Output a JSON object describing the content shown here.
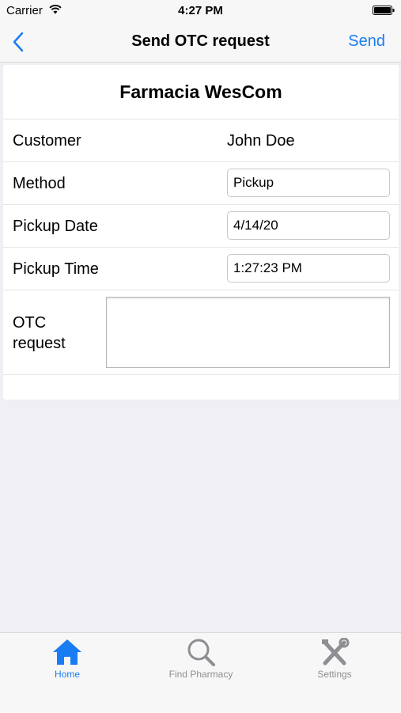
{
  "status_bar": {
    "carrier": "Carrier",
    "time": "4:27 PM"
  },
  "nav": {
    "title": "Send OTC request",
    "send_label": "Send"
  },
  "pharmacy_name": "Farmacia WesCom",
  "form": {
    "customer_label": "Customer",
    "customer_value": "John Doe",
    "method_label": "Method",
    "method_value": "Pickup",
    "pickup_date_label": "Pickup Date",
    "pickup_date_value": "4/14/20",
    "pickup_time_label": "Pickup Time",
    "pickup_time_value": "1:27:23 PM",
    "otc_label_line1": "OTC",
    "otc_label_line2": "request",
    "otc_value": ""
  },
  "tabs": [
    {
      "label": "Home",
      "icon": "home-icon",
      "active": true
    },
    {
      "label": "Find Pharmacy",
      "icon": "search-icon",
      "active": false
    },
    {
      "label": "Settings",
      "icon": "tools-icon",
      "active": false
    }
  ],
  "colors": {
    "accent": "#1a7cf4",
    "inactive": "#8e8e93",
    "background": "#efeff4"
  }
}
